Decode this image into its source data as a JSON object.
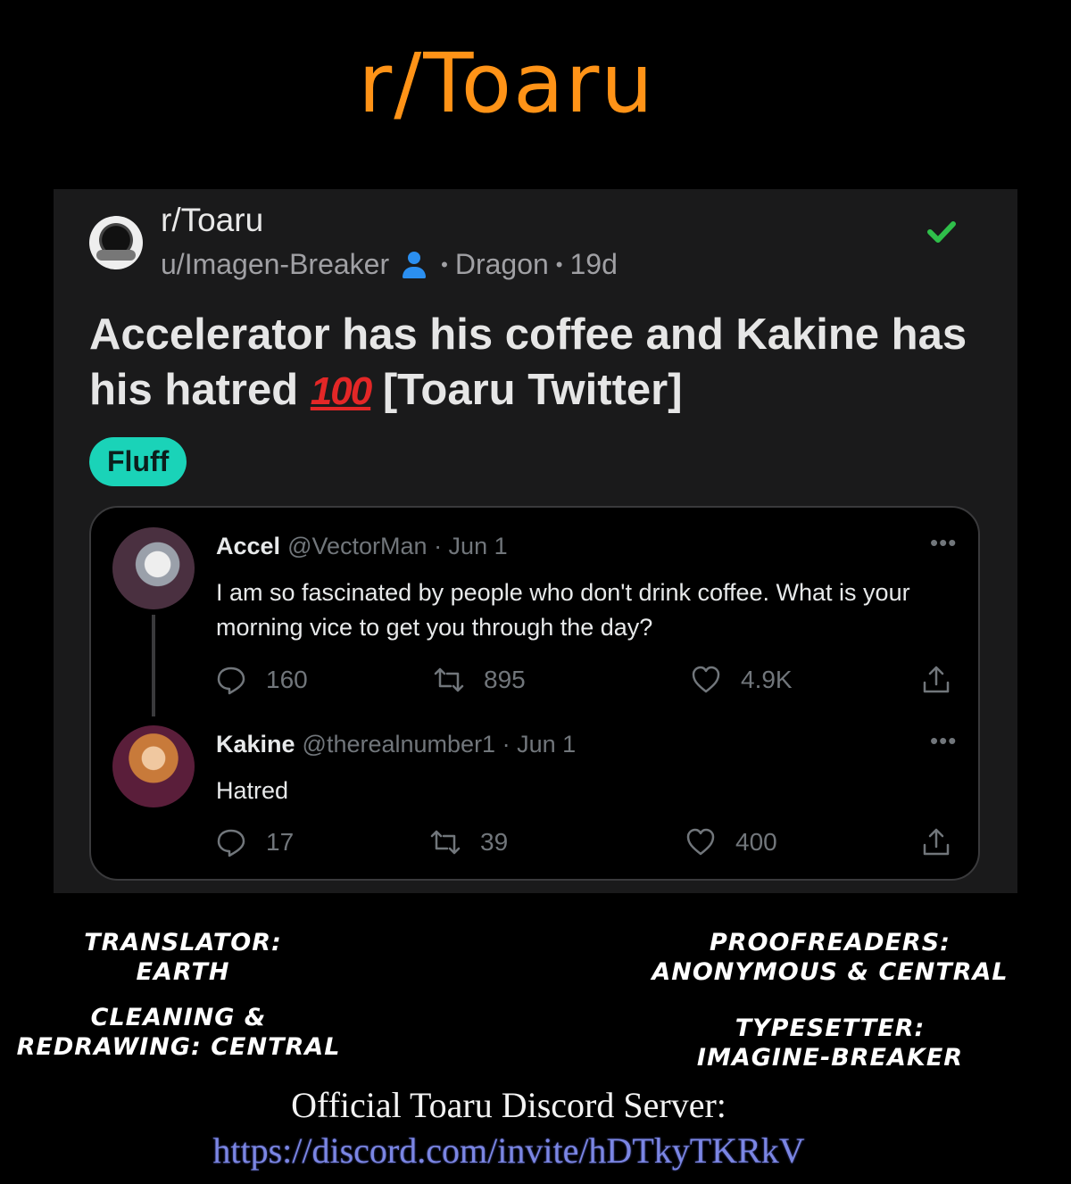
{
  "banner": {
    "title": "r/Toaru"
  },
  "post": {
    "subreddit": "r/Toaru",
    "author": "u/Imagen-Breaker",
    "separator1": "•",
    "flair_user": "Dragon",
    "separator2": "•",
    "age": "19d",
    "title_part1": "Accelerator has his coffee and Kakine has his hatred ",
    "title_emoji": "100",
    "title_part2": " [Toaru Twitter]",
    "flair": "Fluff",
    "colors": {
      "flair_bg": "#1ad3b8",
      "verified_check": "#2fbf4a",
      "user_icon": "#2b8ff0"
    },
    "icons": [
      "subreddit-avatar",
      "user-icon",
      "check-icon"
    ]
  },
  "tweets": [
    {
      "name": "Accel",
      "handle": "@VectorMan",
      "date": "· Jun 1",
      "more": "•••",
      "text": "I am so fascinated by people who don't drink coffee. What is your morning vice to get you through the day?",
      "replies": "160",
      "retweets": "895",
      "likes": "4.9K"
    },
    {
      "name": "Kakine",
      "handle": "@therealnumber1",
      "date": "· Jun 1",
      "more": "•••",
      "text": "Hatred",
      "replies": "17",
      "retweets": "39",
      "likes": "400"
    }
  ],
  "credits": {
    "translator": "Translator:",
    "translator_name": "Earth",
    "cleaning": "Cleaning &",
    "cleaning2": "Redrawing: Central",
    "proofreaders": "Proofreaders:",
    "proofreaders_names": "Anonymous & Central",
    "typesetter": "Typesetter:",
    "typesetter_name": "Imagine-Breaker"
  },
  "discord": {
    "label": "Official Toaru Discord Server:",
    "link": "https://discord.com/invite/hDTkyTKRkV"
  }
}
